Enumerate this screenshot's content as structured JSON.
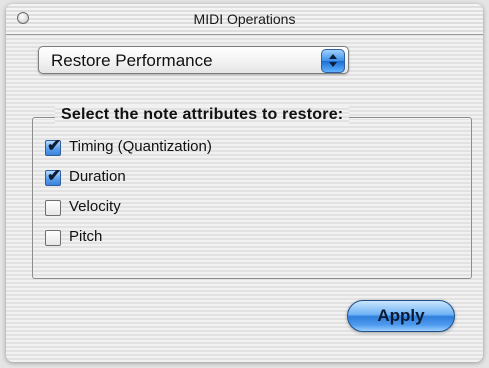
{
  "window": {
    "title": "MIDI Operations"
  },
  "popup": {
    "selected": "Restore Performance"
  },
  "group": {
    "title": "Select the note attributes to restore:",
    "options": [
      {
        "label": "Timing (Quantization)",
        "checked": true
      },
      {
        "label": "Duration",
        "checked": true
      },
      {
        "label": "Velocity",
        "checked": false
      },
      {
        "label": "Pitch",
        "checked": false
      }
    ],
    "checkmark_glyph": "✔"
  },
  "buttons": {
    "apply": "Apply"
  },
  "colors": {
    "aqua_blue": "#3d8ee6",
    "stripe_light": "#f1f1f1",
    "stripe_dark": "#e2e2e2"
  }
}
